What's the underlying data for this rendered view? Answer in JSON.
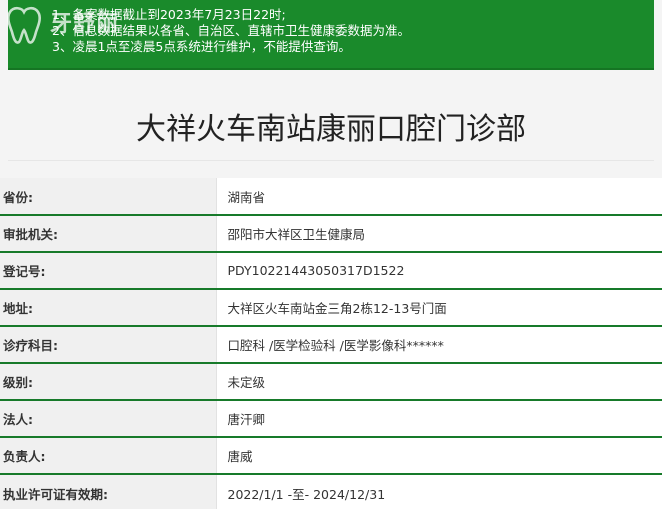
{
  "notice": {
    "lines": [
      "1、备案数据截止到2023年7月23日22时;",
      "2、信息数据结果以各省、自治区、直辖市卫生健康委数据为准。",
      "3、凌晨1点至凌晨5点系统进行维护，不能提供查询。"
    ]
  },
  "logo": {
    "brand": "牙舒丽",
    "icon": "tooth-icon"
  },
  "title": "大祥火车南站康丽口腔门诊部",
  "rows": [
    {
      "label": "省份:",
      "value": "湖南省"
    },
    {
      "label": "审批机关:",
      "value": "邵阳市大祥区卫生健康局"
    },
    {
      "label": "登记号:",
      "value": "PDY10221443050317D1522"
    },
    {
      "label": "地址:",
      "value": "大祥区火车南站金三角2栋12-13号门面"
    },
    {
      "label": "诊疗科目:",
      "value": "口腔科 /医学检验科 /医学影像科******"
    },
    {
      "label": "级别:",
      "value": "未定级"
    },
    {
      "label": "法人:",
      "value": "唐汗卿"
    },
    {
      "label": "负责人:",
      "value": "唐威"
    },
    {
      "label": "执业许可证有效期:",
      "value": "2022/1/1 -至- 2024/12/31"
    }
  ],
  "colors": {
    "notice_bg": "#1a8a2b",
    "row_border": "#177a2a"
  }
}
